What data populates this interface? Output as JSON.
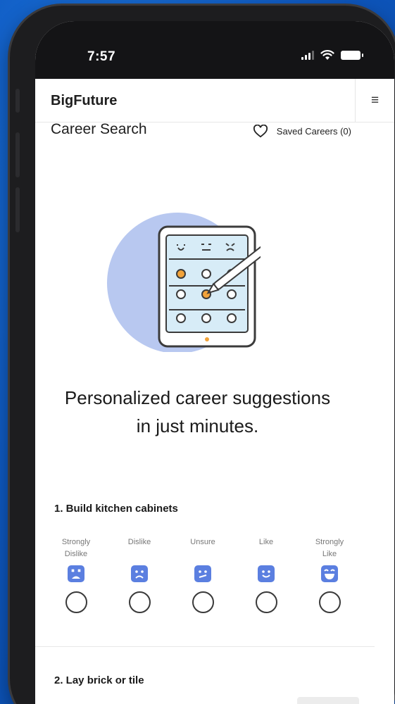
{
  "status": {
    "time": "7:57"
  },
  "header": {
    "brand": "BigFuture",
    "menu_icon": "hamburger-icon"
  },
  "search": {
    "title": "Career Search",
    "saved_label": "Saved Careers (0)",
    "saved_icon": "heart-outline-icon"
  },
  "hero": {
    "illustration": "tablet-survey-illustration",
    "line1": "Personalized career suggestions",
    "line2": "in just minutes."
  },
  "questions": [
    {
      "title": "1. Build kitchen cabinets",
      "options": [
        {
          "line1": "Strongly",
          "line2": "Dislike",
          "icon": "very-sad-face-icon"
        },
        {
          "line1": "Dislike",
          "line2": "",
          "icon": "sad-face-icon"
        },
        {
          "line1": "Unsure",
          "line2": "",
          "icon": "unsure-face-icon"
        },
        {
          "line1": "Like",
          "line2": "",
          "icon": "smile-face-icon"
        },
        {
          "line1": "Strongly",
          "line2": "Like",
          "icon": "big-smile-face-icon"
        }
      ]
    },
    {
      "title": "2. Lay brick or tile"
    }
  ],
  "colors": {
    "face": "#5b7fe0",
    "illustration_circle": "#b8c8f0",
    "tablet_screen": "#d7ecf7",
    "accent_orange": "#f2a33a",
    "background_blue": "#0e58c0"
  }
}
